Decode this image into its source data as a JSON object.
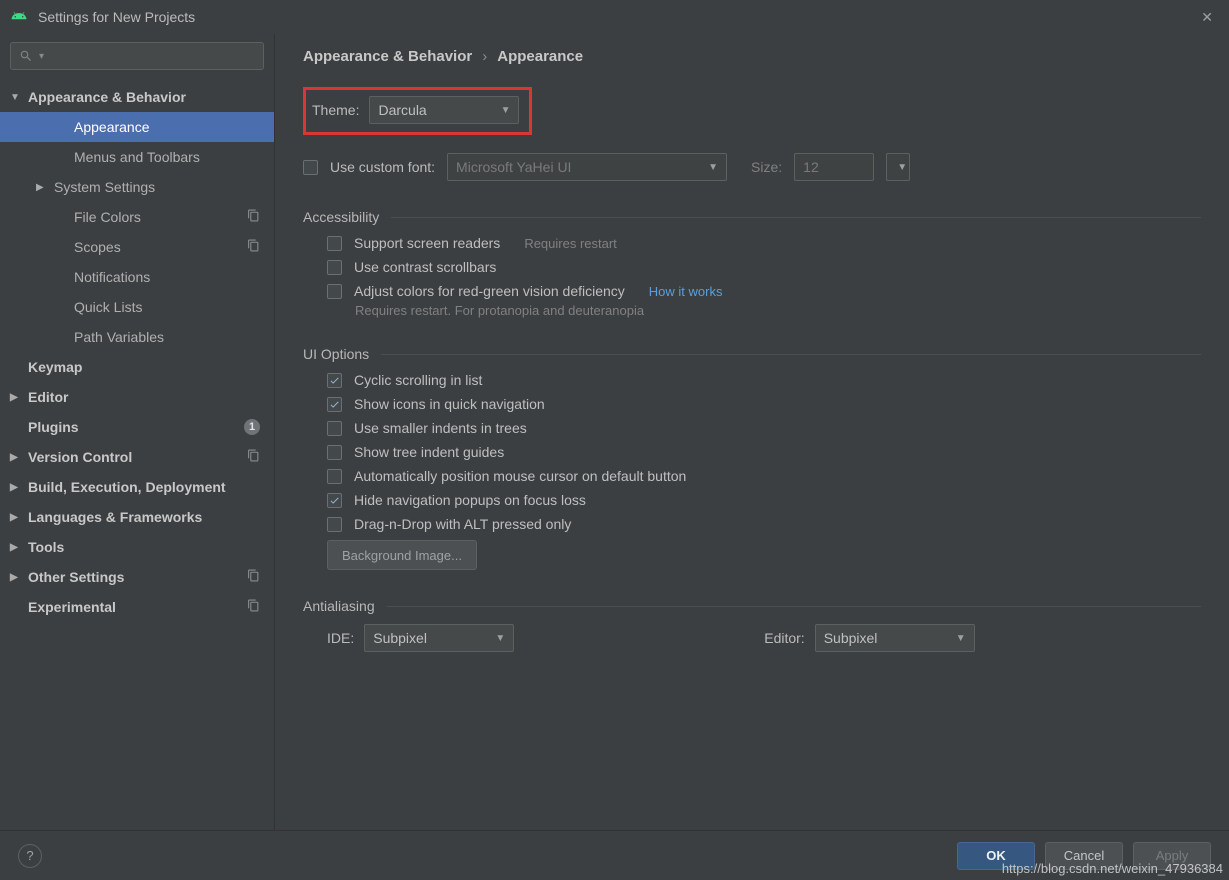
{
  "window": {
    "title": "Settings for New Projects"
  },
  "search": {
    "placeholder": ""
  },
  "sidebar": {
    "items": [
      {
        "label": "Appearance & Behavior",
        "level": 0,
        "arrow": "down",
        "bold": true
      },
      {
        "label": "Appearance",
        "level": 2,
        "selected": true
      },
      {
        "label": "Menus and Toolbars",
        "level": 2
      },
      {
        "label": "System Settings",
        "level": 1,
        "arrow": "right"
      },
      {
        "label": "File Colors",
        "level": 2,
        "icon": "copy"
      },
      {
        "label": "Scopes",
        "level": 2,
        "icon": "copy"
      },
      {
        "label": "Notifications",
        "level": 2
      },
      {
        "label": "Quick Lists",
        "level": 2
      },
      {
        "label": "Path Variables",
        "level": 2
      },
      {
        "label": "Keymap",
        "level": 0,
        "bold": true
      },
      {
        "label": "Editor",
        "level": 0,
        "arrow": "right",
        "bold": true
      },
      {
        "label": "Plugins",
        "level": 0,
        "bold": true,
        "badge": "1"
      },
      {
        "label": "Version Control",
        "level": 0,
        "arrow": "right",
        "bold": true,
        "icon": "copy"
      },
      {
        "label": "Build, Execution, Deployment",
        "level": 0,
        "arrow": "right",
        "bold": true
      },
      {
        "label": "Languages & Frameworks",
        "level": 0,
        "arrow": "right",
        "bold": true
      },
      {
        "label": "Tools",
        "level": 0,
        "arrow": "right",
        "bold": true
      },
      {
        "label": "Other Settings",
        "level": 0,
        "arrow": "right",
        "bold": true,
        "icon": "copy"
      },
      {
        "label": "Experimental",
        "level": 0,
        "bold": true,
        "icon": "copy"
      }
    ]
  },
  "breadcrumb": {
    "part1": "Appearance & Behavior",
    "sep": "›",
    "part2": "Appearance"
  },
  "theme": {
    "label": "Theme:",
    "value": "Darcula"
  },
  "customFont": {
    "checked": false,
    "label": "Use custom font:",
    "fontValue": "Microsoft YaHei UI",
    "sizeLabel": "Size:",
    "sizeValue": "12"
  },
  "accessibility": {
    "title": "Accessibility",
    "items": [
      {
        "label": "Support screen readers",
        "checked": false,
        "hintInline": "Requires restart"
      },
      {
        "label": "Use contrast scrollbars",
        "checked": false
      },
      {
        "label": "Adjust colors for red-green vision deficiency",
        "checked": false,
        "link": "How it works",
        "hintBelow": "Requires restart. For protanopia and deuteranopia"
      }
    ]
  },
  "uiOptions": {
    "title": "UI Options",
    "items": [
      {
        "label": "Cyclic scrolling in list",
        "checked": true
      },
      {
        "label": "Show icons in quick navigation",
        "checked": true
      },
      {
        "label": "Use smaller indents in trees",
        "checked": false
      },
      {
        "label": "Show tree indent guides",
        "checked": false
      },
      {
        "label": "Automatically position mouse cursor on default button",
        "checked": false
      },
      {
        "label": "Hide navigation popups on focus loss",
        "checked": true
      },
      {
        "label": "Drag-n-Drop with ALT pressed only",
        "checked": false
      }
    ],
    "bgButton": "Background Image..."
  },
  "antialiasing": {
    "title": "Antialiasing",
    "ideLabel": "IDE:",
    "ideValue": "Subpixel",
    "editorLabel": "Editor:",
    "editorValue": "Subpixel"
  },
  "footer": {
    "ok": "OK",
    "cancel": "Cancel",
    "apply": "Apply"
  },
  "watermark": "https://blog.csdn.net/weixin_47936384"
}
